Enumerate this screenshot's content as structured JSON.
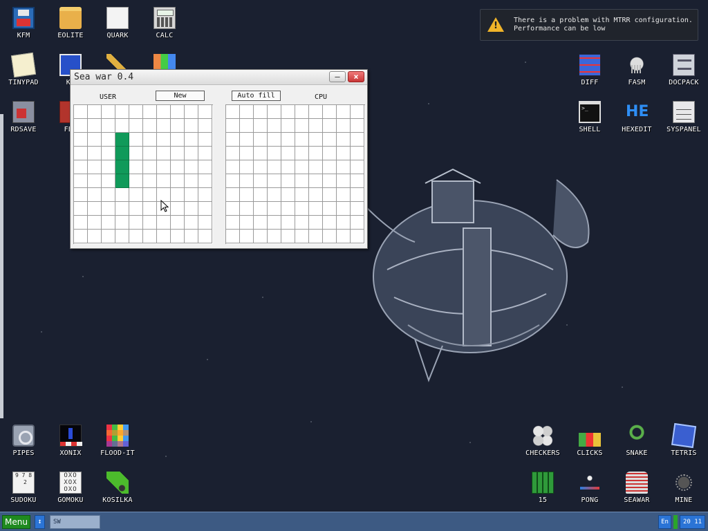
{
  "desktop": {
    "icons": [
      {
        "label": "KFM",
        "icon": "floppy-icon"
      },
      {
        "label": "EOLITE",
        "icon": "folder-icon"
      },
      {
        "label": "QUARK",
        "icon": "book-icon"
      },
      {
        "label": "CALC",
        "icon": "calculator-icon"
      },
      {
        "label": "TINYPAD",
        "icon": "notepad-icon"
      },
      {
        "label": "KF",
        "icon": "kf-icon"
      },
      {
        "label": "RDSAVE",
        "icon": "rdsave-icon"
      },
      {
        "label": "FB2",
        "icon": "fb2-icon"
      },
      {
        "label": "DIFF",
        "icon": "diff-icon"
      },
      {
        "label": "FASM",
        "icon": "fasm-icon"
      },
      {
        "label": "DOCPACK",
        "icon": "docpack-icon"
      },
      {
        "label": "SHELL",
        "icon": "terminal-icon"
      },
      {
        "label": "HEXEDIT",
        "icon": "hexedit-icon"
      },
      {
        "label": "SYSPANEL",
        "icon": "syspanel-icon"
      },
      {
        "label": "PIPES",
        "icon": "pipes-icon"
      },
      {
        "label": "XONIX",
        "icon": "xonix-icon"
      },
      {
        "label": "FLOOD-IT",
        "icon": "flood-it-icon"
      },
      {
        "label": "SUDOKU",
        "icon": "sudoku-icon"
      },
      {
        "label": "GOMOKU",
        "icon": "gomoku-icon"
      },
      {
        "label": "KOSILKA",
        "icon": "lawnmower-icon"
      },
      {
        "label": "CHECKERS",
        "icon": "checkers-icon"
      },
      {
        "label": "CLICKS",
        "icon": "clicks-icon"
      },
      {
        "label": "SNAKE",
        "icon": "snake-icon"
      },
      {
        "label": "TETRIS",
        "icon": "tetris-icon"
      },
      {
        "label": "15",
        "icon": "fifteen-puzzle-icon"
      },
      {
        "label": "PONG",
        "icon": "pong-icon"
      },
      {
        "label": "SEAWAR",
        "icon": "seawar-icon"
      },
      {
        "label": "MINE",
        "icon": "mine-icon"
      }
    ],
    "hexedit_glyph": "HE",
    "shell_glyph": ">_",
    "sudoku_glyph": "9 7 8\n  2 ",
    "gomoku_glyph": "OXO\nXOX\nOXO"
  },
  "notification": {
    "icon": "warning-icon",
    "line1": "There is a problem with MTRR configuration.",
    "line2": "Performance can be low"
  },
  "window": {
    "title": "Sea war 0.4",
    "minimize_label": "–",
    "close_label": "×",
    "user_label": "USER",
    "cpu_label": "CPU",
    "new_button": "New",
    "autofill_button": "Auto fill",
    "grid_size": 10,
    "user_ship_cells": [
      [
        3,
        2
      ],
      [
        3,
        3
      ],
      [
        3,
        4
      ],
      [
        3,
        5
      ]
    ],
    "ship_color": "#109a5a"
  },
  "taskbar": {
    "menu_label": "Menu",
    "switch_glyph": "↕",
    "task_text": "SW",
    "lang": "En",
    "clock": "20 11"
  }
}
